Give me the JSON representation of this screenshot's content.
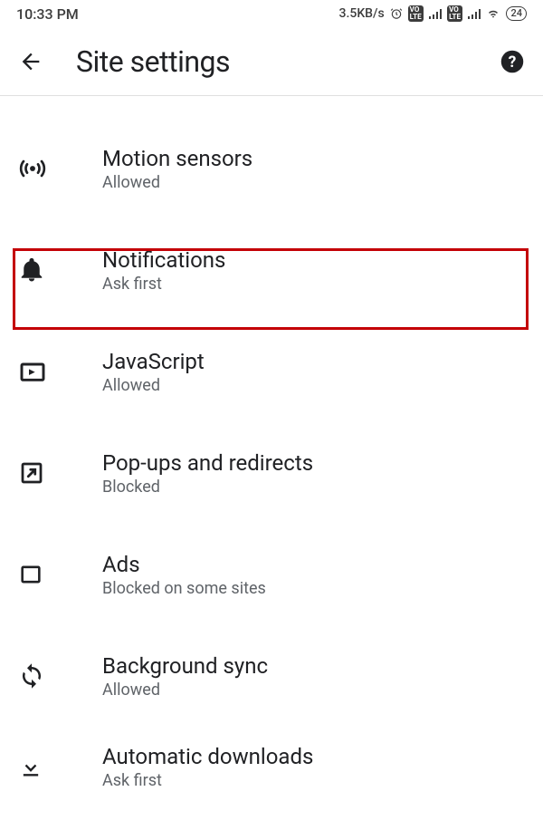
{
  "status": {
    "time": "10:33 PM",
    "rate": "3.5KB/s",
    "battery": "24"
  },
  "header": {
    "title": "Site settings"
  },
  "partial_top_sub": "",
  "items": [
    {
      "title": "Motion sensors",
      "sub": "Allowed"
    },
    {
      "title": "Notifications",
      "sub": "Ask first"
    },
    {
      "title": "JavaScript",
      "sub": "Allowed"
    },
    {
      "title": "Pop-ups and redirects",
      "sub": "Blocked"
    },
    {
      "title": "Ads",
      "sub": "Blocked on some sites"
    },
    {
      "title": "Background sync",
      "sub": "Allowed"
    },
    {
      "title": "Automatic downloads",
      "sub": "Ask first"
    }
  ]
}
